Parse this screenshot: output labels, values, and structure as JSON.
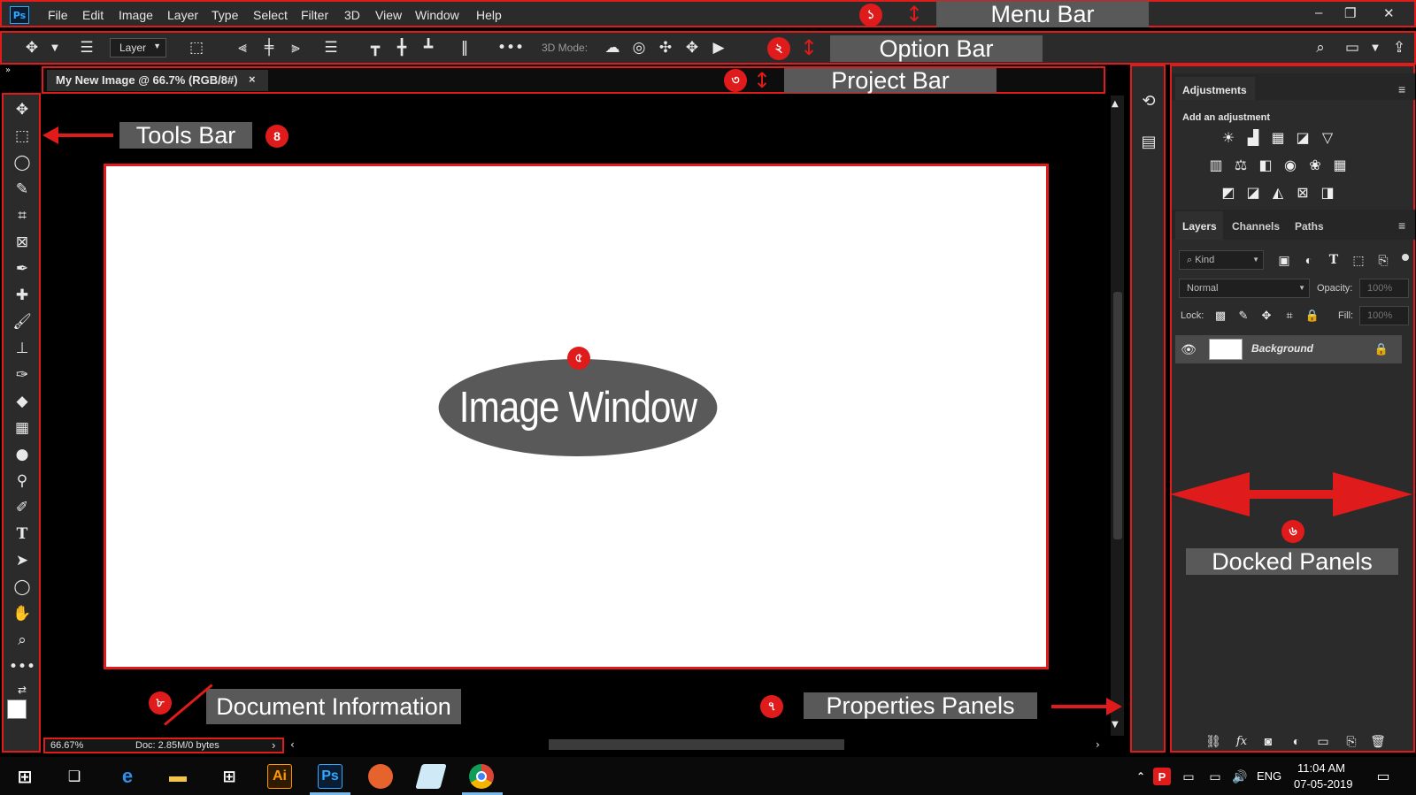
{
  "menubar": {
    "logo": "Ps",
    "items": [
      "File",
      "Edit",
      "Image",
      "Layer",
      "Type",
      "Select",
      "Filter",
      "3D",
      "View",
      "Window",
      "Help"
    ],
    "window_controls": [
      "–",
      "❐",
      "✕"
    ]
  },
  "optionbar": {
    "layer_select": "Layer",
    "mode_label": "3D Mode:"
  },
  "project": {
    "tab_title": "My New Image @ 66.7% (RGB/8#)",
    "close": "×"
  },
  "image_window": {
    "label": "Image Window"
  },
  "status": {
    "zoom": "66.67%",
    "doc_info": "Doc: 2.85M/0 bytes"
  },
  "adjustments": {
    "tab": "Adjustments",
    "subtitle": "Add an adjustment"
  },
  "layers": {
    "tabs": [
      "Layers",
      "Channels",
      "Paths"
    ],
    "search_placeholder": "Kind",
    "blend_mode": "Normal",
    "opacity_label": "Opacity:",
    "opacity_value": "100%",
    "lock_label": "Lock:",
    "fill_label": "Fill:",
    "fill_value": "100%",
    "layer_name": "Background"
  },
  "annotations": {
    "menu_bar": "Menu Bar",
    "option_bar": "Option Bar",
    "project_bar": "Project Bar",
    "tools_bar": "Tools Bar",
    "docked_panels": "Docked Panels",
    "document_information": "Document Information",
    "properties_panels": "Properties Panels",
    "badges": [
      "১",
      "২",
      "৩",
      "8",
      "৫",
      "৬",
      "৮",
      "৭"
    ]
  },
  "taskbar": {
    "language": "ENG",
    "time": "11:04 AM",
    "date": "07-05-2019",
    "illustrator": "Ai",
    "photoshop": "Ps"
  },
  "colors": {
    "accent_red": "#e01b1b",
    "panel_bg": "#2b2b2b",
    "label_bg": "#595959"
  }
}
